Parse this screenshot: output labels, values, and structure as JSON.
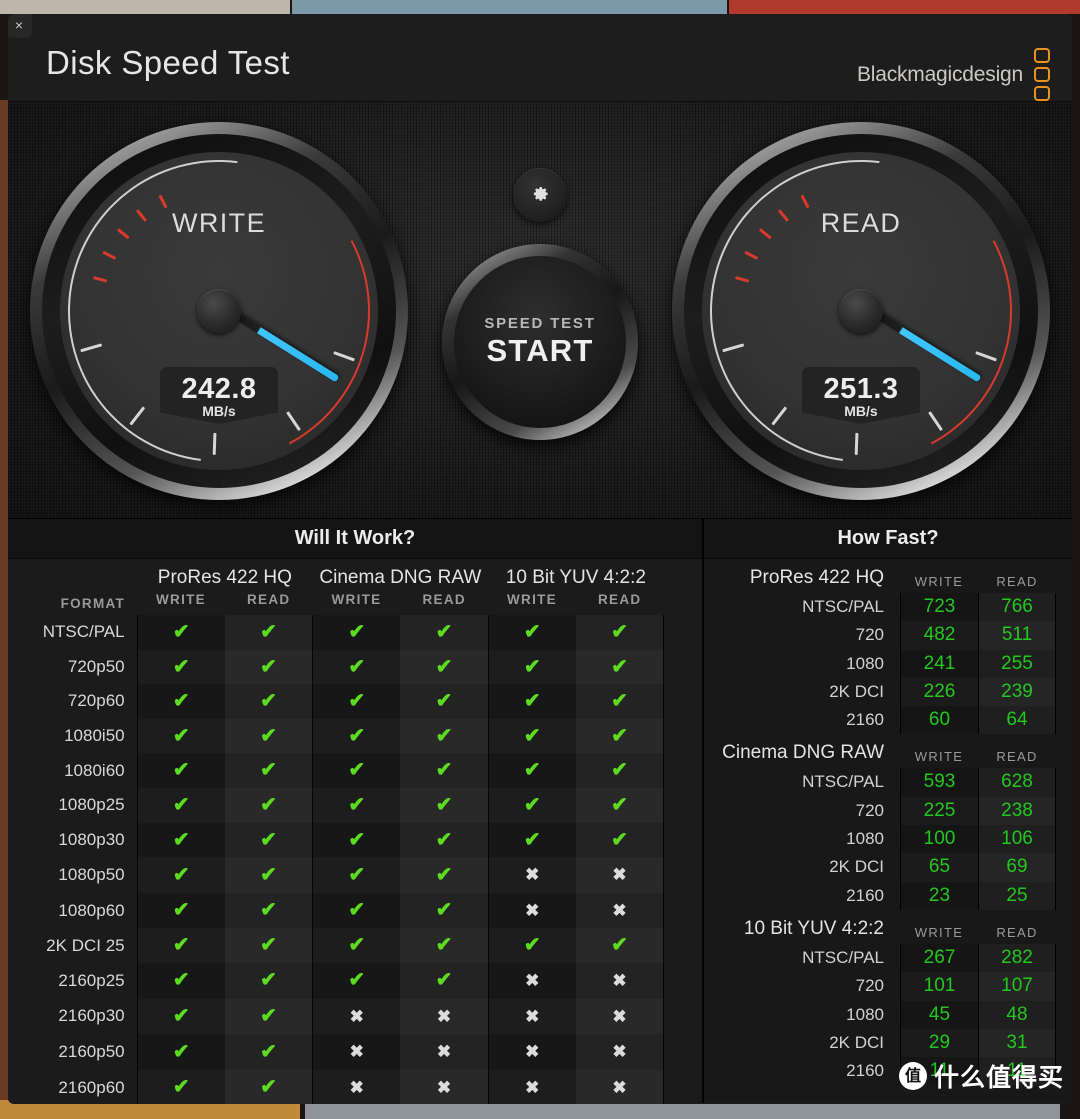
{
  "window": {
    "close_label": "×"
  },
  "header": {
    "title": "Disk Speed Test",
    "brand": "Blackmagicdesign"
  },
  "gauges": {
    "write": {
      "label": "WRITE",
      "value": "242.8",
      "unit": "MB/s",
      "needle_deg": 212
    },
    "read": {
      "label": "READ",
      "value": "251.3",
      "unit": "MB/s",
      "needle_deg": 212
    },
    "gear_icon": "gear-icon",
    "start_button": {
      "sub": "SPEED TEST",
      "main": "START"
    }
  },
  "will_it_work": {
    "title": "Will It Work?",
    "format_header": "FORMAT",
    "codecs": [
      "ProRes 422 HQ",
      "Cinema DNG RAW",
      "10 Bit YUV 4:2:2"
    ],
    "sub_headers": [
      "WRITE",
      "READ"
    ],
    "ok_glyph": "✔",
    "no_glyph": "✖",
    "rows": [
      {
        "format": "NTSC/PAL",
        "cells": [
          true,
          true,
          true,
          true,
          true,
          true
        ]
      },
      {
        "format": "720p50",
        "cells": [
          true,
          true,
          true,
          true,
          true,
          true
        ]
      },
      {
        "format": "720p60",
        "cells": [
          true,
          true,
          true,
          true,
          true,
          true
        ]
      },
      {
        "format": "1080i50",
        "cells": [
          true,
          true,
          true,
          true,
          true,
          true
        ]
      },
      {
        "format": "1080i60",
        "cells": [
          true,
          true,
          true,
          true,
          true,
          true
        ]
      },
      {
        "format": "1080p25",
        "cells": [
          true,
          true,
          true,
          true,
          true,
          true
        ]
      },
      {
        "format": "1080p30",
        "cells": [
          true,
          true,
          true,
          true,
          true,
          true
        ]
      },
      {
        "format": "1080p50",
        "cells": [
          true,
          true,
          true,
          true,
          false,
          false
        ]
      },
      {
        "format": "1080p60",
        "cells": [
          true,
          true,
          true,
          true,
          false,
          false
        ]
      },
      {
        "format": "2K DCI 25",
        "cells": [
          true,
          true,
          true,
          true,
          true,
          true
        ]
      },
      {
        "format": "2160p25",
        "cells": [
          true,
          true,
          true,
          true,
          false,
          false
        ]
      },
      {
        "format": "2160p30",
        "cells": [
          true,
          true,
          false,
          false,
          false,
          false
        ]
      },
      {
        "format": "2160p50",
        "cells": [
          true,
          true,
          false,
          false,
          false,
          false
        ]
      },
      {
        "format": "2160p60",
        "cells": [
          true,
          true,
          false,
          false,
          false,
          false
        ]
      }
    ]
  },
  "how_fast": {
    "title": "How Fast?",
    "col_write": "WRITE",
    "col_read": "READ",
    "blocks": [
      {
        "title": "ProRes 422 HQ",
        "rows": [
          {
            "name": "NTSC/PAL",
            "write": "723",
            "read": "766"
          },
          {
            "name": "720",
            "write": "482",
            "read": "511"
          },
          {
            "name": "1080",
            "write": "241",
            "read": "255"
          },
          {
            "name": "2K DCI",
            "write": "226",
            "read": "239"
          },
          {
            "name": "2160",
            "write": "60",
            "read": "64"
          }
        ]
      },
      {
        "title": "Cinema DNG RAW",
        "rows": [
          {
            "name": "NTSC/PAL",
            "write": "593",
            "read": "628"
          },
          {
            "name": "720",
            "write": "225",
            "read": "238"
          },
          {
            "name": "1080",
            "write": "100",
            "read": "106"
          },
          {
            "name": "2K DCI",
            "write": "65",
            "read": "69"
          },
          {
            "name": "2160",
            "write": "23",
            "read": "25"
          }
        ]
      },
      {
        "title": "10 Bit YUV 4:2:2",
        "rows": [
          {
            "name": "NTSC/PAL",
            "write": "267",
            "read": "282"
          },
          {
            "name": "720",
            "write": "101",
            "read": "107"
          },
          {
            "name": "1080",
            "write": "45",
            "read": "48"
          },
          {
            "name": "2K DCI",
            "write": "29",
            "read": "31"
          },
          {
            "name": "2160",
            "write": "11",
            "read": "11"
          }
        ]
      }
    ]
  },
  "watermark": {
    "logo": "值",
    "text": "什么值得买"
  },
  "colors": {
    "needle": "#3fc7ff",
    "ok": "#5ddb20",
    "value_green": "#22c81e",
    "brand_orange": "#e8921f",
    "redline": "#d93b2b"
  }
}
